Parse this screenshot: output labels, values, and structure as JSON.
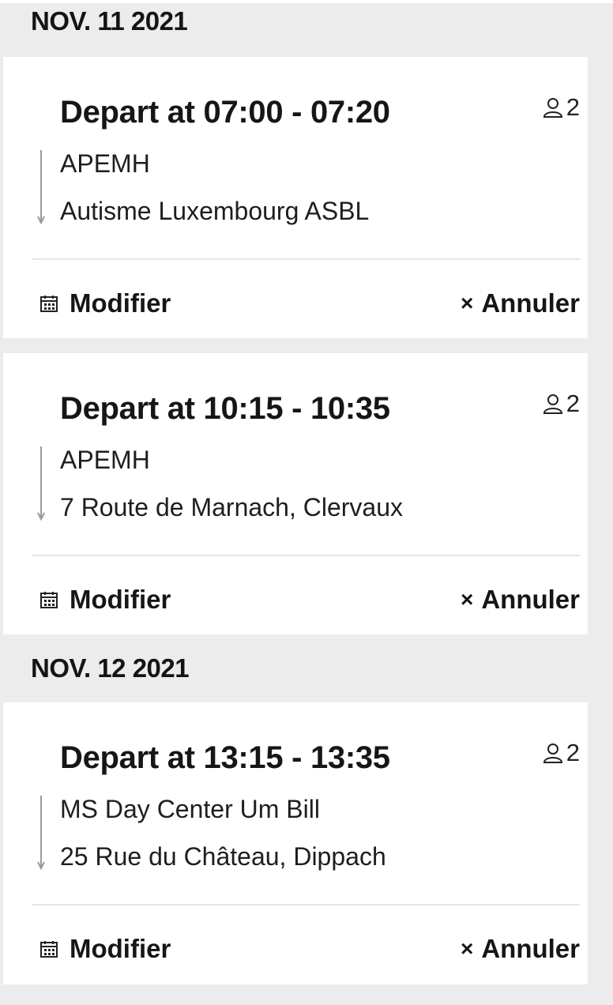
{
  "days": [
    {
      "date": "NOV. 11 2021",
      "trips": [
        {
          "title": "Depart at 07:00 - 07:20",
          "passengers": "2",
          "from": "APEMH",
          "to": "Autisme Luxembourg ASBL",
          "modify_label": "Modifier",
          "cancel_label": "Annuler"
        },
        {
          "title": "Depart at 10:15 - 10:35",
          "passengers": "2",
          "from": "APEMH",
          "to": "7 Route de Marnach, Clervaux",
          "modify_label": "Modifier",
          "cancel_label": "Annuler"
        }
      ]
    },
    {
      "date": "NOV. 12 2021",
      "trips": [
        {
          "title": "Depart at 13:15 - 13:35",
          "passengers": "2",
          "from": "MS Day Center Um Bill",
          "to": "25 Rue du Château, Dippach",
          "modify_label": "Modifier",
          "cancel_label": "Annuler"
        }
      ]
    }
  ],
  "icons": {
    "passenger": "person-icon",
    "modify": "calendar-icon",
    "cancel": "close-icon"
  },
  "colors": {
    "background": "#ececec",
    "card": "#ffffff",
    "text": "#161616",
    "route_line": "#9a9a9a",
    "divider": "#e6e6e6"
  }
}
